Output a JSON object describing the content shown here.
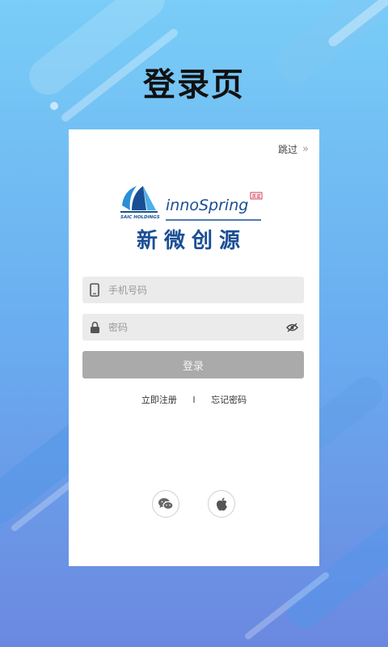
{
  "page_title": "登录页",
  "skip": {
    "label": "跳过",
    "chevron": "»"
  },
  "logo": {
    "saic_text": "SAIC HOLDINGS",
    "brand_text": "innoSpring",
    "badge": "英诺",
    "chinese_name": "新微创源"
  },
  "form": {
    "phone_placeholder": "手机号码",
    "password_placeholder": "密码",
    "login_label": "登录"
  },
  "links": {
    "register": "立即注册",
    "separator": "I",
    "forgot": "忘记密码"
  },
  "colors": {
    "brand_blue": "#1a4e94",
    "brand_red": "#c8102e",
    "button_disabled": "#aaaaaa"
  },
  "icons": [
    "phone-icon",
    "lock-icon",
    "eye-off-icon",
    "wechat-icon",
    "apple-icon",
    "chevron-right-double-icon"
  ]
}
